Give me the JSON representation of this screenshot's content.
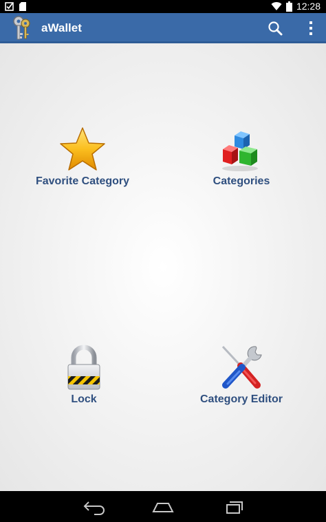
{
  "status_bar": {
    "time": "12:28",
    "icons": [
      "checkbox-notification-icon",
      "sd-card-icon",
      "wifi-icon",
      "battery-icon"
    ]
  },
  "action_bar": {
    "title": "aWallet",
    "logo_icon": "keys-icon",
    "actions": [
      "search-icon",
      "overflow-menu-icon"
    ],
    "background_color": "#3a6aa8"
  },
  "tiles": [
    {
      "label": "Favorite Category",
      "icon": "star-icon"
    },
    {
      "label": "Categories",
      "icon": "cubes-icon"
    },
    {
      "label": "Lock",
      "icon": "padlock-icon"
    },
    {
      "label": "Category Editor",
      "icon": "tools-icon"
    }
  ],
  "nav_bar": {
    "buttons": [
      "back-icon",
      "home-icon",
      "recents-icon"
    ]
  },
  "colors": {
    "label": "#2f4f7f",
    "star": "#f6b400",
    "cube_blue": "#2e8ae0",
    "cube_red": "#e02020",
    "cube_green": "#2fb52f"
  }
}
